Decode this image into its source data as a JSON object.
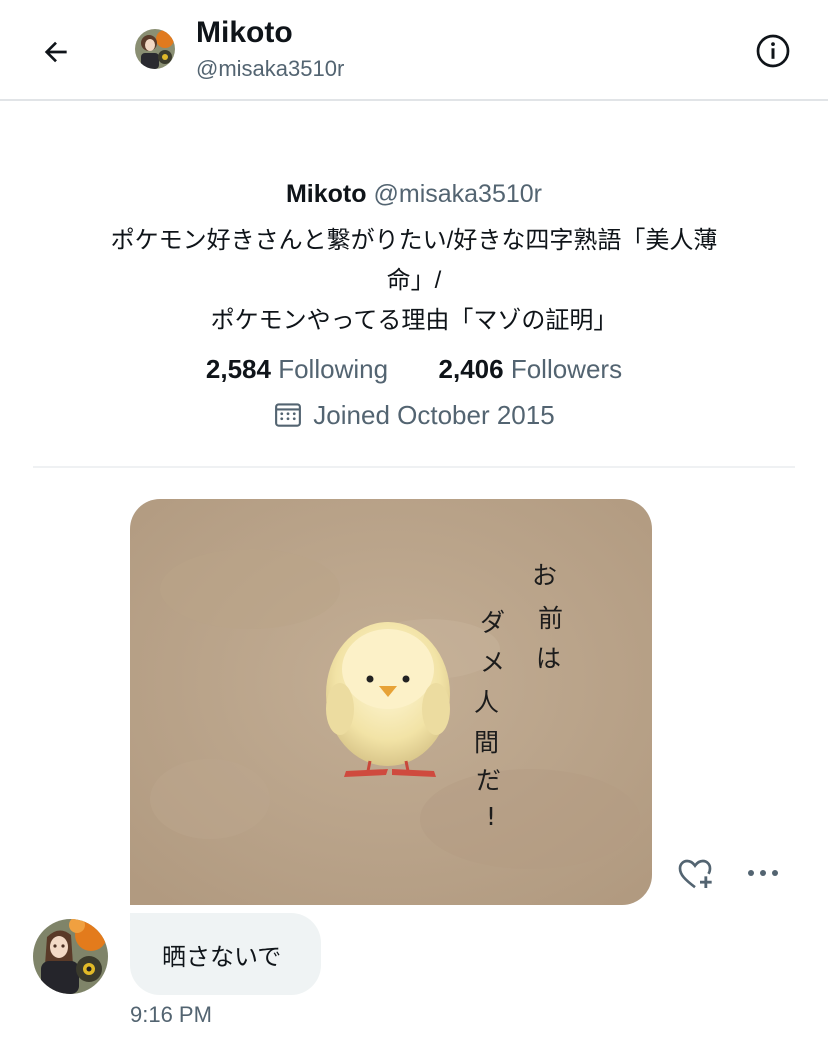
{
  "header": {
    "name": "Mikoto",
    "handle": "@misaka3510r"
  },
  "profile": {
    "name": "Mikoto",
    "handle": "@misaka3510r",
    "bio_lines": [
      "ポケモン好きさんと繋がりたい/好きな四字熟語「美人薄",
      "命」/",
      "ポケモンやってる理由「マゾの証明」"
    ],
    "following_count": "2,584",
    "following_label": "Following",
    "followers_count": "2,406",
    "followers_label": "Followers",
    "joined": "Joined October 2015"
  },
  "media": {
    "caption_chars": [
      "お",
      "前",
      "は",
      "ダ",
      "メ",
      "人",
      "間",
      "だ",
      "!"
    ]
  },
  "message": {
    "text": "晒さないで",
    "time": "9:16 PM"
  },
  "icons": {
    "back": "arrow-left-icon",
    "info": "info-circle-icon",
    "calendar": "calendar-icon",
    "react": "heart-plus-icon",
    "more": "more-horizontal-icon"
  },
  "colors": {
    "text_primary": "#0f1419",
    "text_secondary": "#536471",
    "bubble": "#eff3f4",
    "divider": "#eff1f3"
  }
}
